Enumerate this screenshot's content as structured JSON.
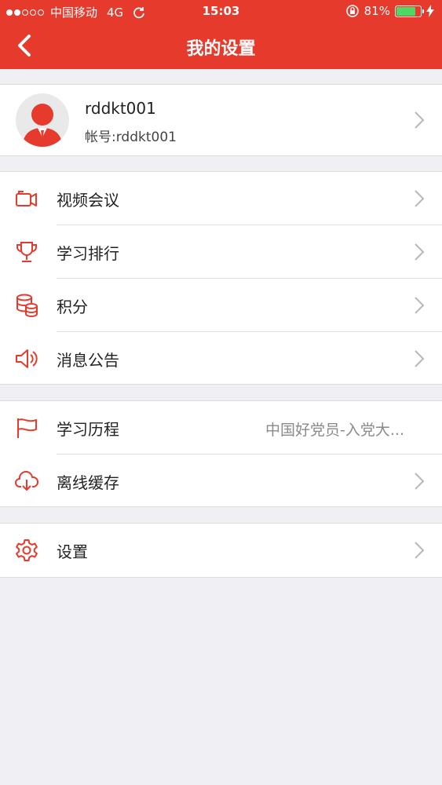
{
  "status_bar": {
    "carrier": "中国移动",
    "network": "4G",
    "time": "15:03",
    "battery": "81%",
    "battery_level": 0.81
  },
  "navbar": {
    "title": "我的设置"
  },
  "profile": {
    "name": "rddkt001",
    "account": "帐号:rddkt001"
  },
  "group1": [
    {
      "label": "视频会议",
      "icon": "video-camera-icon"
    },
    {
      "label": "学习排行",
      "icon": "trophy-icon"
    },
    {
      "label": "积分",
      "icon": "coins-icon"
    },
    {
      "label": "消息公告",
      "icon": "speaker-icon"
    }
  ],
  "group2": [
    {
      "label": "学习历程",
      "icon": "flag-icon",
      "value": "中国好党员-入党大..."
    },
    {
      "label": "离线缓存",
      "icon": "cloud-download-icon"
    }
  ],
  "group3": [
    {
      "label": "设置",
      "icon": "gear-icon"
    }
  ],
  "colors": {
    "brand": "#e63a2c",
    "background": "#efeff4",
    "battery": "#4cd964"
  }
}
